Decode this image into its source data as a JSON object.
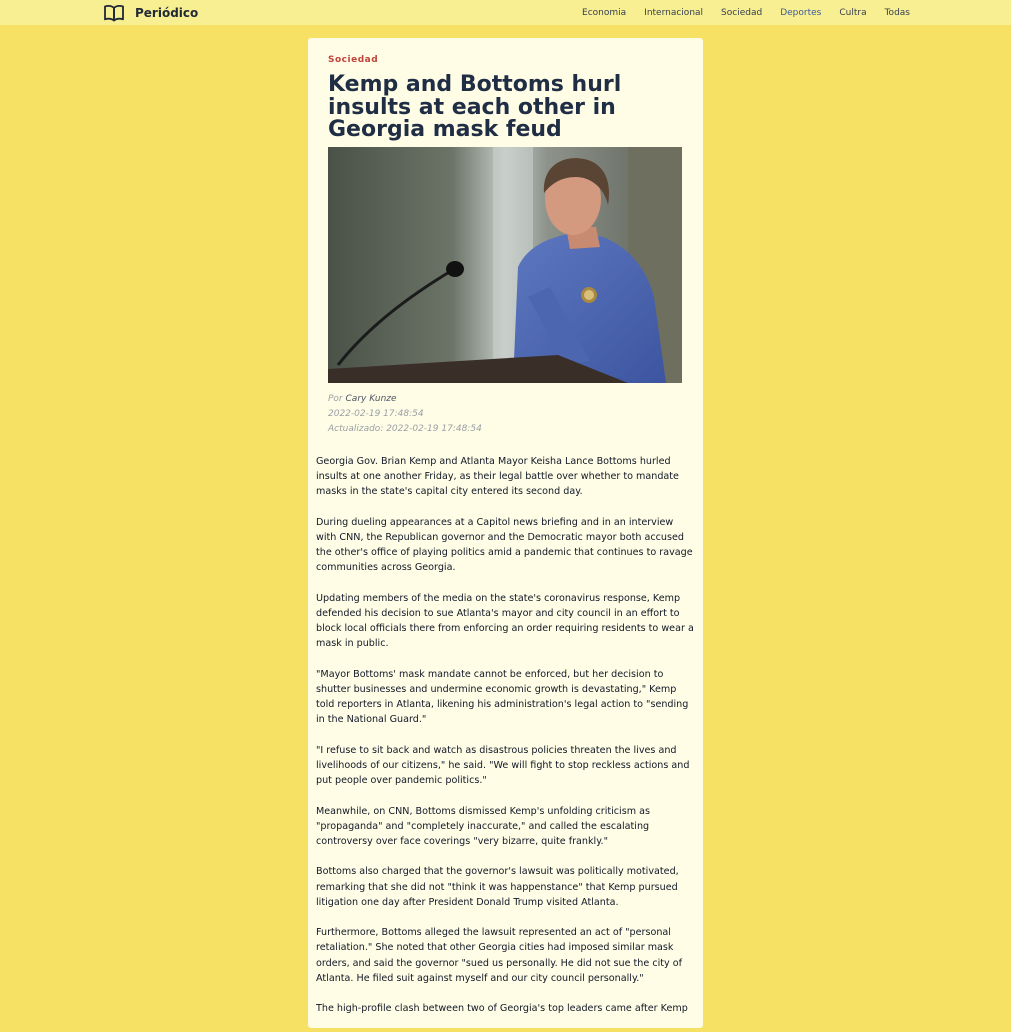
{
  "nav": {
    "brand": "Periódico",
    "brand_icon": "open-book-icon",
    "links": [
      "Economia",
      "Internacional",
      "Sociedad",
      "Deportes",
      "Cultra",
      "Todas"
    ],
    "active_link": "Deportes",
    "active_color": "#3b5b9b"
  },
  "article": {
    "category": "Sociedad",
    "category_color": "#c0443b",
    "title": "Kemp and Bottoms hurl insults at each other in Georgia mask feud",
    "byline_prefix": "Por",
    "author": "Cary Kunze",
    "published": "2022-02-19 17:48:54",
    "updated": "Actualizado: 2022-02-19 17:48:54",
    "paragraphs": [
      "Georgia Gov. Brian Kemp and Atlanta Mayor Keisha Lance Bottoms hurled insults at one another Friday, as their legal battle over whether to mandate masks in the state's capital city entered its second day.",
      "During dueling appearances at a Capitol news briefing and in an interview with CNN, the Republican governor and the Democratic mayor both accused the other's office of playing politics amid a pandemic that continues to ravage communities across Georgia.",
      "Updating members of the media on the state's coronavirus response, Kemp defended his decision to sue Atlanta's mayor and city council in an effort to block local officials there from enforcing an order requiring residents to wear a mask in public.",
      "\"Mayor Bottoms' mask mandate cannot be enforced, but her decision to shutter businesses and undermine economic growth is devastating,\" Kemp told reporters in Atlanta, likening his administration's legal action to \"sending in the National Guard.\"",
      "\"I refuse to sit back and watch as disastrous policies threaten the lives and livelihoods of our citizens,\" he said. \"We will fight to stop reckless actions and put people over pandemic politics.\"",
      "Meanwhile, on CNN, Bottoms dismissed Kemp's unfolding criticism as \"propaganda\" and \"completely inaccurate,\" and called the escalating controversy over face coverings \"very bizarre, quite frankly.\"",
      "Bottoms also charged that the governor's lawsuit was politically motivated, remarking that she did not \"think it was happenstance\" that Kemp pursued litigation one day after President Donald Trump visited Atlanta.",
      "Furthermore, Bottoms alleged the lawsuit represented an act of \"personal retaliation.\" She noted that other Georgia cities had imposed similar mask orders, and said the governor \"sued us personally. He did not sue the city of Atlanta. He filed suit against myself and our city council personally.\"",
      "The high-profile clash between two of Georgia's top leaders came after Kemp"
    ]
  }
}
